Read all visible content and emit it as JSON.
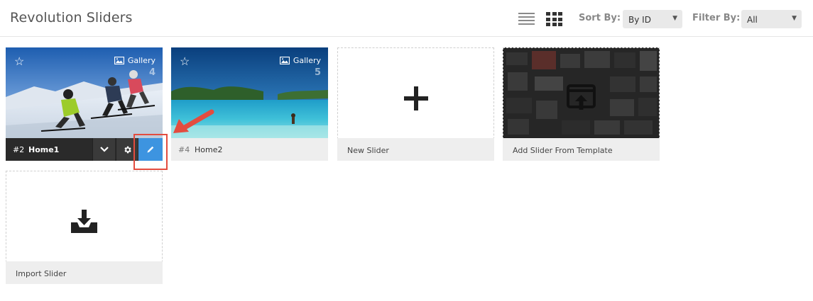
{
  "header": {
    "title": "Revolution Sliders",
    "sort_label": "Sort By:",
    "sort_value": "By ID",
    "filter_label": "Filter By:",
    "filter_value": "All"
  },
  "sliders": [
    {
      "id": "#2",
      "name": "Home1",
      "type": "Gallery",
      "count": "4"
    },
    {
      "id": "#4",
      "name": "Home2",
      "type": "Gallery",
      "count": "5"
    }
  ],
  "actions": {
    "new_slider": "New Slider",
    "template": "Add Slider From Template",
    "import": "Import Slider"
  },
  "colors": {
    "edit_button": "#3d94e0",
    "highlight": "#e34c3f",
    "dark_footer": "#2a2a2a"
  },
  "icons": {
    "list_view": "list-view-icon",
    "grid_view": "grid-view-icon",
    "favorite": "star-outline-icon",
    "gallery": "image-icon",
    "dropdown": "chevron-down-icon",
    "settings": "gear-icon",
    "edit": "pencil-icon",
    "new": "plus-icon",
    "template": "window-upload-icon",
    "import": "tray-download-icon"
  }
}
